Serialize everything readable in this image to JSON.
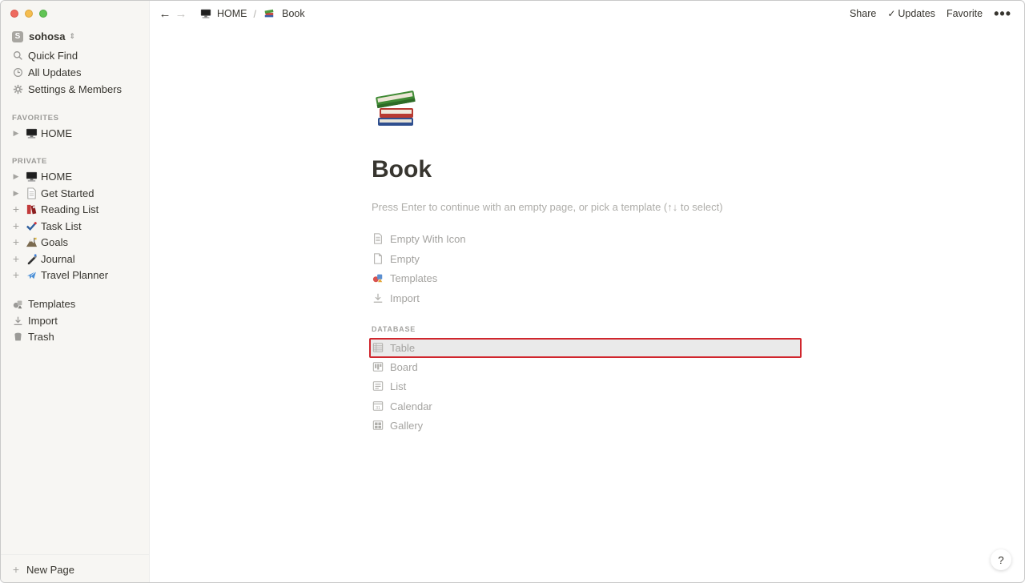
{
  "workspace": {
    "badge": "S",
    "name": "sohosa"
  },
  "sidebar": {
    "top_items": [
      {
        "label": "Quick Find",
        "icon": "search-icon"
      },
      {
        "label": "All Updates",
        "icon": "clock-icon"
      },
      {
        "label": "Settings & Members",
        "icon": "gear-icon"
      }
    ],
    "favorites_title": "FAVORITES",
    "favorites": [
      {
        "label": "HOME",
        "icon": "computer-emoji"
      }
    ],
    "private_title": "PRIVATE",
    "private": [
      {
        "label": "HOME",
        "icon": "computer-emoji",
        "toggle": "caret"
      },
      {
        "label": "Get Started",
        "icon": "page-icon",
        "toggle": "caret"
      },
      {
        "label": "Reading List",
        "icon": "books-emoji",
        "toggle": "plus"
      },
      {
        "label": "Task List",
        "icon": "check-emoji",
        "toggle": "plus"
      },
      {
        "label": "Goals",
        "icon": "mountain-emoji",
        "toggle": "plus"
      },
      {
        "label": "Journal",
        "icon": "pen-emoji",
        "toggle": "plus"
      },
      {
        "label": "Travel Planner",
        "icon": "airplane-emoji",
        "toggle": "plus"
      }
    ],
    "bottom_items": [
      {
        "label": "Templates",
        "icon": "templates-icon"
      },
      {
        "label": "Import",
        "icon": "download-icon"
      },
      {
        "label": "Trash",
        "icon": "trash-icon"
      }
    ],
    "new_page": "New Page"
  },
  "topbar": {
    "breadcrumb": [
      {
        "label": "HOME",
        "icon": "computer-emoji"
      },
      {
        "label": "Book",
        "icon": "books-emoji"
      }
    ],
    "separator": "/",
    "share": "Share",
    "updates": "Updates",
    "favorite": "Favorite",
    "more": "•••"
  },
  "page": {
    "icon": "books-emoji",
    "title": "Book",
    "hint": "Press Enter to continue with an empty page, or pick a template (↑↓ to select)",
    "options": [
      {
        "label": "Empty With Icon",
        "icon": "page-lines-icon"
      },
      {
        "label": "Empty",
        "icon": "page-icon"
      },
      {
        "label": "Templates",
        "icon": "templates-icon"
      },
      {
        "label": "Import",
        "icon": "download-icon"
      }
    ],
    "database_title": "DATABASE",
    "database": [
      {
        "label": "Table",
        "icon": "table-icon",
        "selected": true
      },
      {
        "label": "Board",
        "icon": "board-icon"
      },
      {
        "label": "List",
        "icon": "list-icon"
      },
      {
        "label": "Calendar",
        "icon": "calendar-icon"
      },
      {
        "label": "Gallery",
        "icon": "gallery-icon"
      }
    ]
  },
  "help": "?",
  "colors": {
    "sidebar_bg": "#f7f6f3",
    "text": "#37352f",
    "muted": "#a4a3a0",
    "highlight_border": "#d0262d"
  }
}
